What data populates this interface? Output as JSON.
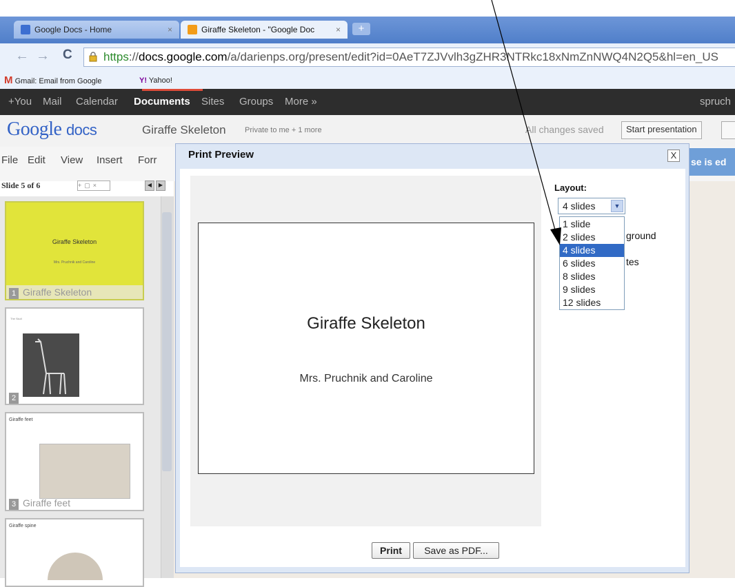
{
  "browser": {
    "tabs": [
      {
        "label": "Google Docs - Home",
        "close": "×"
      },
      {
        "label": "Giraffe Skeleton - \"Google Doc",
        "close": "×"
      }
    ],
    "newtab": "+",
    "url": {
      "scheme": "https",
      "sep": "://",
      "host": "docs.google.com",
      "path": "/a/darienps.org/present/edit?id=0AeT7ZJVvlh3gZHR3NTRkc18xNmZnNWQ4N2Q5&hl=en_US"
    },
    "bookmarks": [
      {
        "label": "Gmail: Email from Google"
      },
      {
        "label": "Yahoo!"
      }
    ]
  },
  "googlebar": {
    "items": [
      "+You",
      "Mail",
      "Calendar",
      "Documents",
      "Sites",
      "Groups",
      "More »"
    ],
    "user": "spruch"
  },
  "docs": {
    "logo_google": "Google",
    "logo_docs": "docs",
    "doc_title": "Giraffe Skeleton",
    "sharing": "Private to me + 1 more",
    "save_status": "All changes saved",
    "start_presentation": "Start presentation",
    "menu": [
      "File",
      "Edit",
      "View",
      "Insert",
      "Forr"
    ],
    "banner": "se is ed",
    "slide_counter": "Slide 5 of 6"
  },
  "thumbnails": [
    {
      "number": "1",
      "caption": "Giraffe Skeleton",
      "title": "Giraffe Skeleton",
      "subtitle": "Mrs. Pruchnik and Caroline"
    },
    {
      "number": "2",
      "caption": "",
      "title": "The Skull"
    },
    {
      "number": "3",
      "caption": "Giraffe feet",
      "title": "Giraffe feet"
    },
    {
      "number": "",
      "caption": "",
      "title": "Giraffe spine"
    }
  ],
  "dialog": {
    "title": "Print Preview",
    "close": "X",
    "layout_label": "Layout:",
    "layout_value": "4 slides",
    "layout_options": [
      "1 slide",
      "2 slides",
      "4 slides",
      "6 slides",
      "8 slides",
      "9 slides",
      "12 slides"
    ],
    "layout_selected": "4 slides",
    "hidden_option_1": "ground",
    "hidden_option_2": "tes",
    "preview_title": "Giraffe Skeleton",
    "preview_subtitle": "Mrs. Pruchnik and Caroline",
    "print_button": "Print",
    "pdf_button": "Save as PDF..."
  },
  "colors": {
    "gbar": "#2d2d2d",
    "selection": "#316ac5",
    "thumb1": "#e1e43a"
  }
}
